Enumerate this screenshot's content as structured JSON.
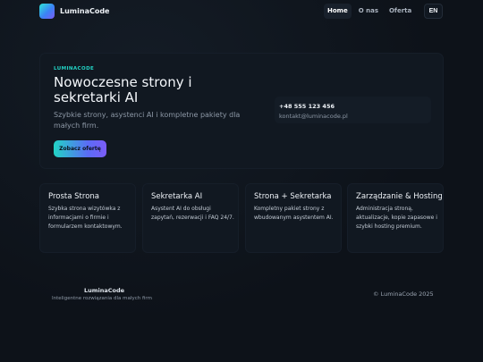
{
  "header": {
    "brand": "LuminaCode",
    "nav": [
      "Home",
      "O nas",
      "Oferta"
    ],
    "active_nav": "Home",
    "lang": "EN"
  },
  "hero": {
    "eyebrow": "LUMINACODE",
    "title": "Nowoczesne strony i sekretarki AI",
    "subtitle": "Szybkie strony, asystenci AI i kompletne pakiety dla małych firm.",
    "cta": "Zobacz ofertę",
    "phone": "+48 555 123 456",
    "email": "kontakt@luminacode.pl"
  },
  "services": [
    {
      "title": "Prosta Strona",
      "description": "Szybka strona wizytówka z informacjami o firmie i formularzem kontaktowym."
    },
    {
      "title": "Sekretarka AI",
      "description": "Asystent AI do obsługi zapytań, rezerwacji i FAQ 24/7."
    },
    {
      "title": "Strona + Sekretarka",
      "description": "Kompletny pakiet strony z wbudowanym asystentem AI."
    },
    {
      "title": "Zarządzanie & Hosting",
      "description": "Administracja stroną, aktualizacje, kopie zapasowe i szybki hosting premium."
    }
  ],
  "footer": {
    "brand": "LuminaCode",
    "tagline": "Inteligentne rozwiązania dla małych firm",
    "copyright": "© LuminaCode 2025"
  },
  "colors": {
    "background": "#0d1219",
    "card": "#111821",
    "accent_teal": "#22d3c5",
    "accent_violet": "#7c5cf6"
  }
}
